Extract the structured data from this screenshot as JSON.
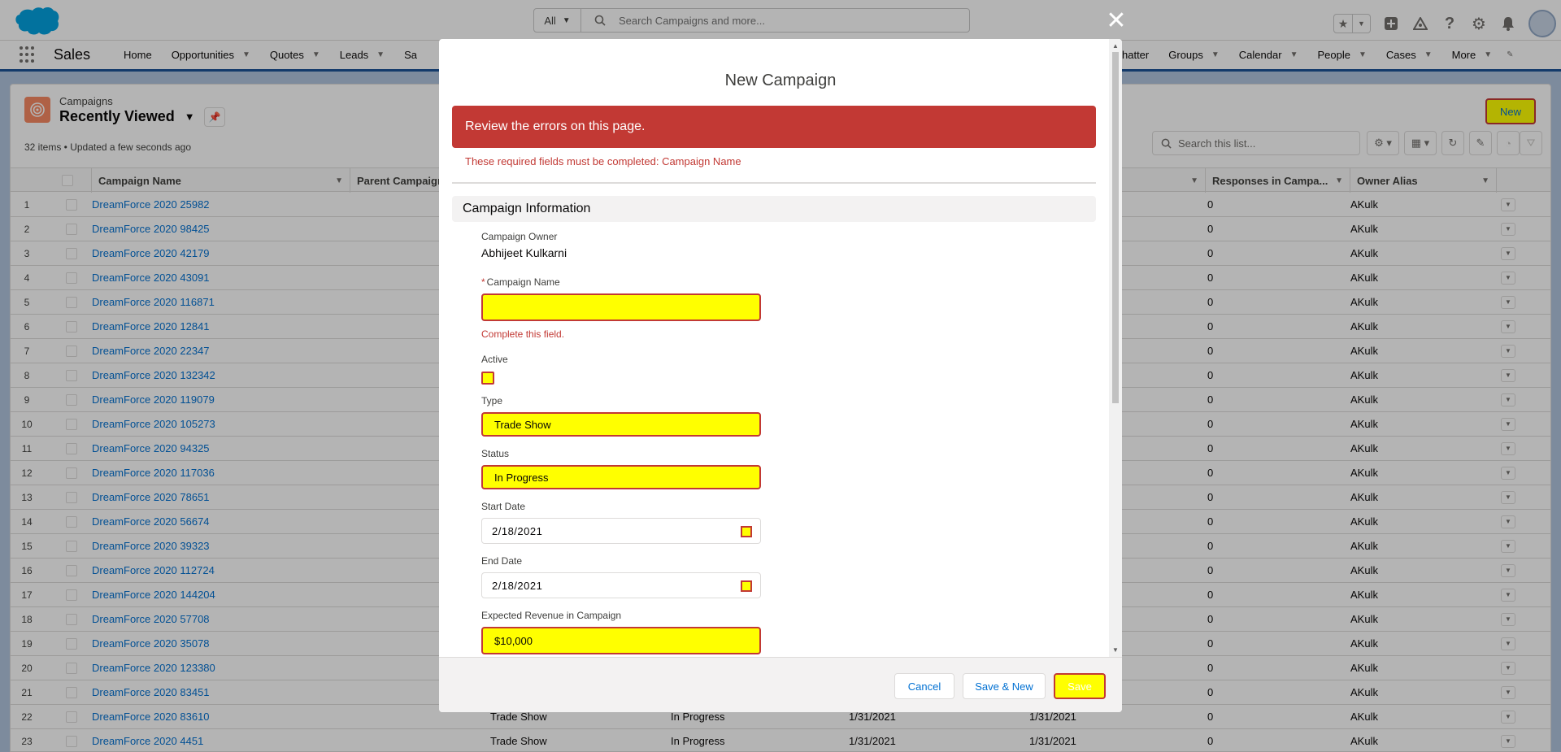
{
  "header": {
    "search_scope": "All",
    "search_placeholder": "Search Campaigns and more..."
  },
  "nav": {
    "app_name": "Sales",
    "items": [
      {
        "label": "Home",
        "chevron": false
      },
      {
        "label": "Opportunities",
        "chevron": true
      },
      {
        "label": "Quotes",
        "chevron": true
      },
      {
        "label": "Leads",
        "chevron": true
      },
      {
        "label": "Sa",
        "chevron": false
      }
    ],
    "items_right": [
      {
        "label": "hatter",
        "chevron": false
      },
      {
        "label": "Groups",
        "chevron": true
      },
      {
        "label": "Calendar",
        "chevron": true
      },
      {
        "label": "People",
        "chevron": true
      },
      {
        "label": "Cases",
        "chevron": true
      },
      {
        "label": "More",
        "chevron": true
      }
    ]
  },
  "list_view": {
    "object_label": "Campaigns",
    "title": "Recently Viewed",
    "meta": "32 items • Updated a few seconds ago",
    "new_button": "New",
    "search_placeholder": "Search this list...",
    "columns": {
      "name": "Campaign Name",
      "parent": "Parent Campaign",
      "responses": "Responses in Campa...",
      "owner": "Owner Alias"
    },
    "rows": [
      {
        "num": "1",
        "name": "DreamForce 2020 25982",
        "type": "",
        "status": "",
        "start": "",
        "end": "",
        "responses": "0",
        "owner": "AKulk"
      },
      {
        "num": "2",
        "name": "DreamForce 2020 98425",
        "type": "",
        "status": "",
        "start": "",
        "end": "",
        "responses": "0",
        "owner": "AKulk"
      },
      {
        "num": "3",
        "name": "DreamForce 2020 42179",
        "type": "",
        "status": "",
        "start": "",
        "end": "",
        "responses": "0",
        "owner": "AKulk"
      },
      {
        "num": "4",
        "name": "DreamForce 2020 43091",
        "type": "",
        "status": "",
        "start": "",
        "end": "",
        "responses": "0",
        "owner": "AKulk"
      },
      {
        "num": "5",
        "name": "DreamForce 2020 116871",
        "type": "",
        "status": "",
        "start": "",
        "end": "",
        "responses": "0",
        "owner": "AKulk"
      },
      {
        "num": "6",
        "name": "DreamForce 2020 12841",
        "type": "",
        "status": "",
        "start": "",
        "end": "",
        "responses": "0",
        "owner": "AKulk"
      },
      {
        "num": "7",
        "name": "DreamForce 2020 22347",
        "type": "",
        "status": "",
        "start": "",
        "end": "",
        "responses": "0",
        "owner": "AKulk"
      },
      {
        "num": "8",
        "name": "DreamForce 2020 132342",
        "type": "",
        "status": "",
        "start": "",
        "end": "",
        "responses": "0",
        "owner": "AKulk"
      },
      {
        "num": "9",
        "name": "DreamForce 2020 119079",
        "type": "",
        "status": "",
        "start": "",
        "end": "",
        "responses": "0",
        "owner": "AKulk"
      },
      {
        "num": "10",
        "name": "DreamForce 2020 105273",
        "type": "",
        "status": "",
        "start": "",
        "end": "",
        "responses": "0",
        "owner": "AKulk"
      },
      {
        "num": "11",
        "name": "DreamForce 2020 94325",
        "type": "",
        "status": "",
        "start": "",
        "end": "",
        "responses": "0",
        "owner": "AKulk"
      },
      {
        "num": "12",
        "name": "DreamForce 2020 117036",
        "type": "",
        "status": "",
        "start": "",
        "end": "",
        "responses": "0",
        "owner": "AKulk"
      },
      {
        "num": "13",
        "name": "DreamForce 2020 78651",
        "type": "",
        "status": "",
        "start": "",
        "end": "",
        "responses": "0",
        "owner": "AKulk"
      },
      {
        "num": "14",
        "name": "DreamForce 2020 56674",
        "type": "",
        "status": "",
        "start": "",
        "end": "",
        "responses": "0",
        "owner": "AKulk"
      },
      {
        "num": "15",
        "name": "DreamForce 2020 39323",
        "type": "",
        "status": "",
        "start": "",
        "end": "",
        "responses": "0",
        "owner": "AKulk"
      },
      {
        "num": "16",
        "name": "DreamForce 2020 112724",
        "type": "",
        "status": "",
        "start": "",
        "end": "",
        "responses": "0",
        "owner": "AKulk"
      },
      {
        "num": "17",
        "name": "DreamForce 2020 144204",
        "type": "",
        "status": "",
        "start": "",
        "end": "",
        "responses": "0",
        "owner": "AKulk"
      },
      {
        "num": "18",
        "name": "DreamForce 2020 57708",
        "type": "",
        "status": "",
        "start": "",
        "end": "",
        "responses": "0",
        "owner": "AKulk"
      },
      {
        "num": "19",
        "name": "DreamForce 2020 35078",
        "type": "",
        "status": "",
        "start": "",
        "end": "",
        "responses": "0",
        "owner": "AKulk"
      },
      {
        "num": "20",
        "name": "DreamForce 2020 123380",
        "type": "",
        "status": "",
        "start": "",
        "end": "",
        "responses": "0",
        "owner": "AKulk"
      },
      {
        "num": "21",
        "name": "DreamForce 2020 83451",
        "type": "",
        "status": "",
        "start": "",
        "end": "",
        "responses": "0",
        "owner": "AKulk"
      },
      {
        "num": "22",
        "name": "DreamForce 2020 83610",
        "type": "Trade Show",
        "status": "In Progress",
        "start": "1/31/2021",
        "end": "1/31/2021",
        "responses": "0",
        "owner": "AKulk"
      },
      {
        "num": "23",
        "name": "DreamForce 2020 4451",
        "type": "Trade Show",
        "status": "In Progress",
        "start": "1/31/2021",
        "end": "1/31/2021",
        "responses": "0",
        "owner": "AKulk"
      }
    ]
  },
  "modal": {
    "title": "New Campaign",
    "error_banner": "Review the errors on this page.",
    "error_detail": "These required fields must be completed: Campaign Name",
    "section_title": "Campaign Information",
    "owner_label": "Campaign Owner",
    "owner_value": "Abhijeet Kulkarni",
    "name_required_mark": "*",
    "name_label": "Campaign Name",
    "name_value": "",
    "name_error": "Complete this field.",
    "active_label": "Active",
    "type_label": "Type",
    "type_value": "Trade Show",
    "status_label": "Status",
    "status_value": "In Progress",
    "start_label": "Start Date",
    "start_value": "2/18/2021",
    "end_label": "End Date",
    "end_value": "2/18/2021",
    "revenue_label": "Expected Revenue in Campaign",
    "revenue_value": "$10,000",
    "cancel": "Cancel",
    "save_new": "Save & New",
    "save": "Save"
  },
  "colors": {
    "brand": "#1b5297",
    "link": "#0070d2",
    "error": "#c23934",
    "highlight": "#ffff00",
    "campaign_icon": "#f88962"
  }
}
